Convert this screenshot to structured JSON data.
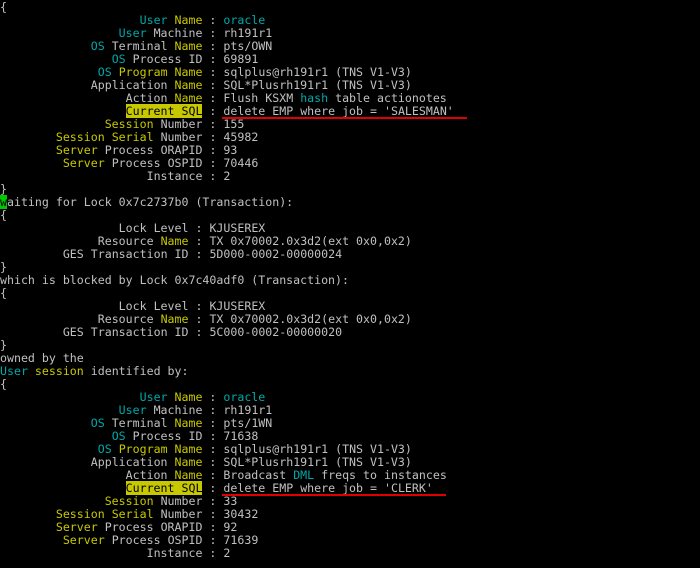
{
  "terminal": {
    "colors": {
      "background": "#000000",
      "text": "#c0c0c0",
      "cyan": "#00a8a8",
      "yellow": "#c8c800",
      "cursor": "#00c800",
      "underline": "#e00000"
    },
    "session1": {
      "open_brace": "{",
      "fields": [
        {
          "label": "User Name",
          "value": "oracle"
        },
        {
          "label": "User Machine",
          "value": "rh191r1"
        },
        {
          "label": "OS Terminal Name",
          "value": "pts/OWN"
        },
        {
          "label": "OS Process ID",
          "value": "69891"
        },
        {
          "label": "OS Program Name",
          "value": "sqlplus@rh191r1 (TNS V1-V3)"
        },
        {
          "label": "Application Name",
          "value": "SQL*Plusrh191r1 (TNS V1-V3)"
        },
        {
          "label": "Action Name",
          "value": "Flush KSXM hash table actionotes"
        },
        {
          "label": "Current SQL",
          "value": "delete EMP where job = 'SALESMAN'"
        },
        {
          "label": "Session Number",
          "value": "155"
        },
        {
          "label": "Session Serial Number",
          "value": "45982"
        },
        {
          "label": "Server Process ORAPID",
          "value": "93"
        },
        {
          "label": "Server Process OSPID",
          "value": "70446"
        },
        {
          "label": "Instance",
          "value": "2"
        }
      ],
      "close_brace": "}"
    },
    "waiting_line": {
      "cursor_char": "w",
      "rest": "aiting for Lock 0x7c2737b0 (Transaction):"
    },
    "lock1": {
      "open_brace": "{",
      "fields": [
        {
          "label": "Lock Level",
          "value": "KJUSEREX"
        },
        {
          "label": "Resource Name",
          "value": "TX 0x70002.0x3d2(ext 0x0,0x2)"
        },
        {
          "label": "GES Transaction ID",
          "value": "5D000-0002-00000024"
        }
      ],
      "close_brace": "}"
    },
    "blocked_line": "which is blocked by Lock 0x7c40adf0 (Transaction):",
    "lock2": {
      "open_brace": "{",
      "fields": [
        {
          "label": "Lock Level",
          "value": "KJUSEREX"
        },
        {
          "label": "Resource Name",
          "value": "TX 0x70002.0x3d2(ext 0x0,0x2)"
        },
        {
          "label": "GES Transaction ID",
          "value": "5C000-0002-00000020"
        }
      ],
      "close_brace": "}"
    },
    "owned_line": "owned by the",
    "identified_line": {
      "word1": "User",
      "word2": "session",
      "rest": " identified by:"
    },
    "session2": {
      "open_brace": "{",
      "fields": [
        {
          "label": "User Name",
          "value": "oracle"
        },
        {
          "label": "User Machine",
          "value": "rh191r1"
        },
        {
          "label": "OS Terminal Name",
          "value": "pts/1WN"
        },
        {
          "label": "OS Process ID",
          "value": "71638"
        },
        {
          "label": "OS Program Name",
          "value": "sqlplus@rh191r1 (TNS V1-V3)"
        },
        {
          "label": "Application Name",
          "value": "SQL*Plusrh191r1 (TNS V1-V3)"
        },
        {
          "label": "Action Name",
          "value": "Broadcast DML freqs to instances"
        },
        {
          "label": "Current SQL",
          "value": "delete EMP where job = 'CLERK'"
        },
        {
          "label": "Session Number",
          "value": "33"
        },
        {
          "label": "Session Serial Number",
          "value": "30432"
        },
        {
          "label": "Server Process ORAPID",
          "value": "92"
        },
        {
          "label": "Server Process OSPID",
          "value": "71639"
        },
        {
          "label": "Instance",
          "value": "2"
        }
      ]
    }
  }
}
